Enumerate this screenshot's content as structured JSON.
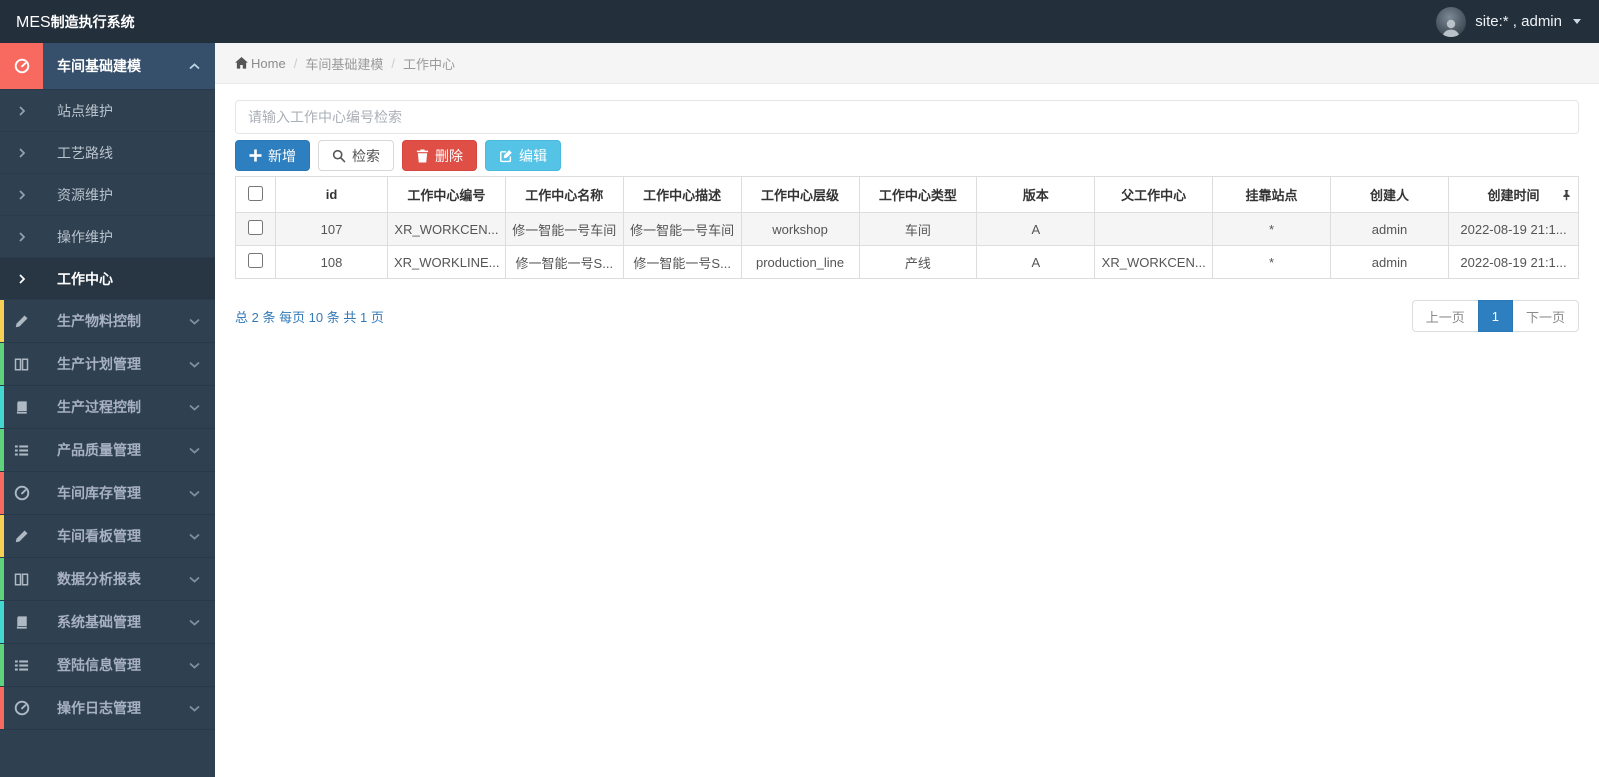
{
  "navbar": {
    "logo_strong": "MES",
    "logo_rest": "制造执行系统",
    "user_label": "site:* , admin"
  },
  "sidebar": {
    "groups": [
      {
        "label": "车间基础建模",
        "icon": "dashboard-icon",
        "accent": "#f8695f",
        "state": "expanded",
        "children": [
          {
            "label": "站点维护",
            "active": false
          },
          {
            "label": "工艺路线",
            "active": false
          },
          {
            "label": "资源维护",
            "active": false
          },
          {
            "label": "操作维护",
            "active": false
          },
          {
            "label": "工作中心",
            "active": true
          }
        ]
      },
      {
        "label": "生产物料控制",
        "icon": "pencil-icon",
        "accent": "#f7d154"
      },
      {
        "label": "生产计划管理",
        "icon": "columns-icon",
        "accent": "#5fd27d"
      },
      {
        "label": "生产过程控制",
        "icon": "book-icon",
        "accent": "#44d7d0"
      },
      {
        "label": "产品质量管理",
        "icon": "list-icon",
        "accent": "#5fd27d"
      },
      {
        "label": "车间库存管理",
        "icon": "dashboard-icon",
        "accent": "#f8695f"
      },
      {
        "label": "车间看板管理",
        "icon": "pencil-icon",
        "accent": "#f7d154"
      },
      {
        "label": "数据分析报表",
        "icon": "columns-icon",
        "accent": "#5fd27d"
      },
      {
        "label": "系统基础管理",
        "icon": "book-icon",
        "accent": "#44d7d0"
      },
      {
        "label": "登陆信息管理",
        "icon": "list-icon",
        "accent": "#5fd27d"
      },
      {
        "label": "操作日志管理",
        "icon": "dashboard-icon",
        "accent": "#f8695f"
      }
    ]
  },
  "breadcrumb": {
    "home": "Home",
    "items": [
      "车间基础建模",
      "工作中心"
    ]
  },
  "search": {
    "placeholder": "请输入工作中心编号检索",
    "value": ""
  },
  "toolbar": {
    "add_label": "新增",
    "search_label": "检索",
    "delete_label": "删除",
    "edit_label": "编辑"
  },
  "table": {
    "columns": [
      "id",
      "工作中心编号",
      "工作中心名称",
      "工作中心描述",
      "工作中心层级",
      "工作中心类型",
      "版本",
      "父工作中心",
      "挂靠站点",
      "创建人",
      "创建时间"
    ],
    "rows": [
      {
        "cells": [
          "107",
          "XR_WORKCEN...",
          "修一智能一号车间",
          "修一智能一号车间",
          "workshop",
          "车间",
          "A",
          "",
          "*",
          "admin",
          "2022-08-19 21:1..."
        ]
      },
      {
        "cells": [
          "108",
          "XR_WORKLINE...",
          "修一智能一号S...",
          "修一智能一号S...",
          "production_line",
          "产线",
          "A",
          "XR_WORKCEN...",
          "*",
          "admin",
          "2022-08-19 21:1..."
        ]
      }
    ]
  },
  "pagination": {
    "summary": "总 2 条 每页 10 条 共 1 页",
    "prev_label": "上一页",
    "current_page": "1",
    "next_label": "下一页"
  },
  "colors": {
    "navbar_bg": "#232f3a",
    "sidebar_bg": "#2f4050",
    "expanded_group_bg": "#36506b",
    "active_submenu_bg": "#283644",
    "accent_red": "#f8695f",
    "accent_yellow": "#f7d154",
    "accent_green": "#5fd27d",
    "accent_teal": "#44d7d0",
    "primary_blue": "#2e7fc0",
    "danger_red": "#df4f45",
    "info_cyan": "#55c3e6",
    "link_blue": "#337ab7"
  }
}
